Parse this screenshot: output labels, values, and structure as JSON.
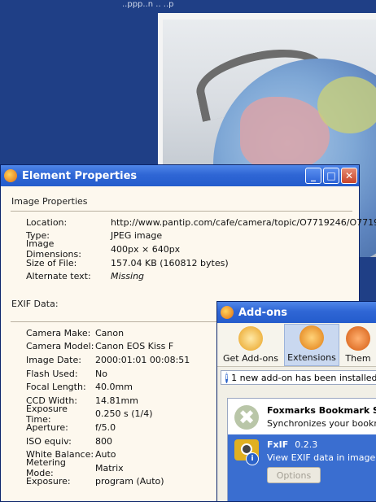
{
  "background": {
    "top_text": "..ppp..n .. ..p"
  },
  "element_properties": {
    "title": "Element Properties",
    "image_section": "Image Properties",
    "image_rows": [
      {
        "label": "Location:",
        "value": "http://www.pantip.com/cafe/camera/topic/O7719246/O7719"
      },
      {
        "label": "Type:",
        "value": "JPEG image"
      },
      {
        "label": "Image Dimensions:",
        "value": "400px × 640px"
      },
      {
        "label": "Size of File:",
        "value": "157.04 KB (160812 bytes)"
      },
      {
        "label": "Alternate text:",
        "value": "Missing"
      }
    ],
    "exif_section": "EXIF Data:",
    "exif_rows": [
      {
        "label": "Camera Make:",
        "value": "Canon"
      },
      {
        "label": "Camera Model:",
        "value": "Canon EOS Kiss F"
      },
      {
        "label": "Image Date:",
        "value": "2000:01:01 00:08:51"
      },
      {
        "label": "Flash Used:",
        "value": "No"
      },
      {
        "label": "Focal Length:",
        "value": "40.0mm"
      },
      {
        "label": "CCD Width:",
        "value": "14.81mm"
      },
      {
        "label": "Exposure Time:",
        "value": "0.250 s (1/4)"
      },
      {
        "label": "Aperture:",
        "value": "f/5.0"
      },
      {
        "label": "ISO equiv:",
        "value": "800"
      },
      {
        "label": "White Balance:",
        "value": "Auto"
      },
      {
        "label": "Metering Mode:",
        "value": "Matrix"
      },
      {
        "label": "Exposure:",
        "value": "program (Auto)"
      }
    ]
  },
  "addons": {
    "title": "Add-ons",
    "tabs": [
      {
        "label": "Get Add-ons",
        "icon": "get-addons-icon"
      },
      {
        "label": "Extensions",
        "icon": "extensions-icon"
      },
      {
        "label": "Them",
        "icon": "themes-icon"
      }
    ],
    "notice": "1 new add-on has been installed.",
    "items": [
      {
        "name": "Foxmarks Bookmark Sy",
        "description": "Synchronizes your bookmark"
      },
      {
        "name": "FxIF",
        "version": "0.2.3",
        "description": "View EXIF data in image prop",
        "options_label": "Options"
      }
    ]
  },
  "colors": {
    "titlebar": "#2f66d5",
    "selection": "#3a6ed0",
    "desktop": "#1f3f86"
  }
}
